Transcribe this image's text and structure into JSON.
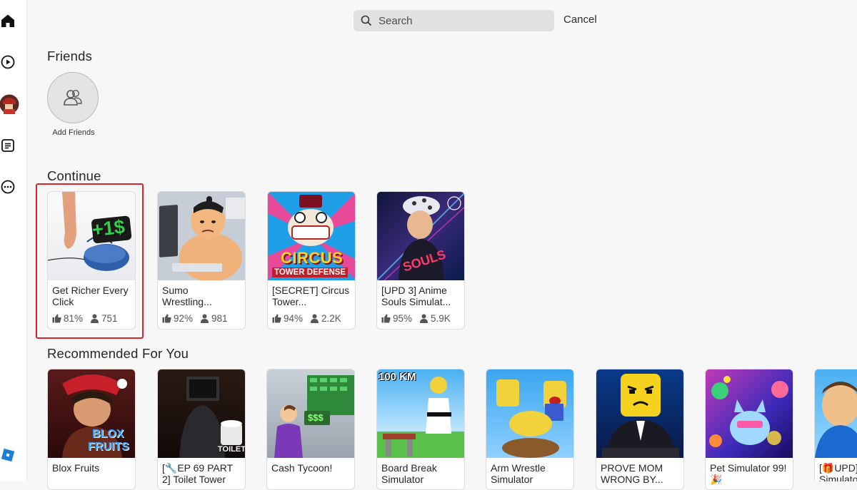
{
  "search": {
    "placeholder": "Search",
    "cancel_label": "Cancel"
  },
  "nav": {
    "items": [
      {
        "name": "home-icon"
      },
      {
        "name": "play-icon"
      },
      {
        "name": "avatar"
      },
      {
        "name": "chat-icon"
      },
      {
        "name": "more-icon"
      },
      {
        "name": "roblox-logo-icon"
      }
    ]
  },
  "friends": {
    "heading": "Friends",
    "add_label": "Add Friends"
  },
  "continue": {
    "heading": "Continue",
    "games": [
      {
        "title": "Get Richer Every Click",
        "rating": "81%",
        "players": "751",
        "thumb_text": "+1$"
      },
      {
        "title": "Sumo Wrestling...",
        "rating": "92%",
        "players": "981"
      },
      {
        "title": "[SECRET] Circus Tower...",
        "rating": "94%",
        "players": "2.2K",
        "thumb_text": "CIRCUS",
        "thumb_text2": "TOWER DEFENSE"
      },
      {
        "title": "[UPD 3] Anime Souls Simulat...",
        "rating": "95%",
        "players": "5.9K"
      }
    ]
  },
  "recommended": {
    "heading": "Recommended For You",
    "games": [
      {
        "title": "Blox Fruits",
        "thumb_text": "BLOX",
        "thumb_text2": "FRUITS"
      },
      {
        "title": "[🔧EP 69 PART 2] Toilet Tower",
        "thumb_text": "TOILET"
      },
      {
        "title": "Cash Tycoon!",
        "thumb_text": "$$$"
      },
      {
        "title": "Board Break Simulator",
        "thumb_text": "100 KM"
      },
      {
        "title": "Arm Wrestle Simulator"
      },
      {
        "title": "PROVE MOM WRONG BY..."
      },
      {
        "title": "Pet Simulator 99! 🎉"
      },
      {
        "title": "[🎁UPD] Simulator"
      }
    ]
  },
  "colors": {
    "highlight": "#d9232d",
    "background": "#f7f7f8"
  }
}
